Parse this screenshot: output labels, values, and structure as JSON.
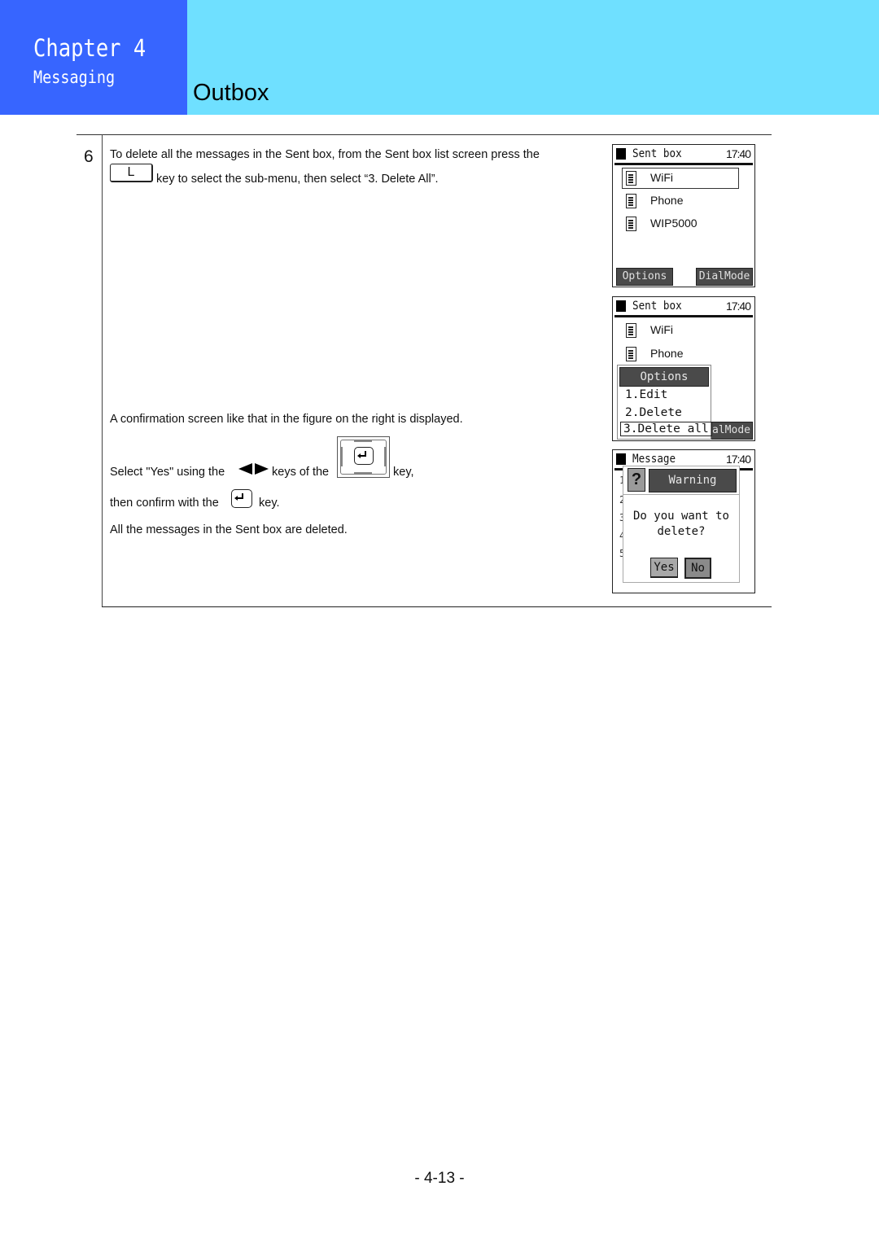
{
  "header": {
    "chapter": "Chapter 4",
    "chapter_subtitle": "Messaging",
    "section_title": "Outbox",
    "colors": {
      "chapter_bg": "#3765ff",
      "section_bg": "#6fe0ff"
    }
  },
  "step": {
    "number": "6",
    "intro_line1": "To delete all the messages in the Sent box, from the Sent box list screen press the",
    "l_key_label": "L",
    "intro_line2": "key to select the sub-menu, then select “3. Delete All”.",
    "confirm_text": "A confirmation screen like that in the figure on the right is displayed.",
    "select_prefix": "Select \"Yes\" using the",
    "select_middle": "keys of the",
    "select_suffix": "key,",
    "confirm_prefix": "then confirm with the",
    "confirm_suffix": "key.",
    "result_text": "All the messages in the Sent box are deleted."
  },
  "screens": {
    "sent_box": {
      "title": "Sent box",
      "time": "17:40",
      "items": [
        {
          "label": "WiFi",
          "selected": true
        },
        {
          "label": "Phone",
          "selected": false
        },
        {
          "label": "WIP5000",
          "selected": false
        }
      ],
      "softkey_left": "Options",
      "softkey_right": "DialMode"
    },
    "options_screen": {
      "title": "Sent box",
      "time": "17:40",
      "items": [
        {
          "label": "WiFi"
        },
        {
          "label": "Phone"
        }
      ],
      "menu_title": "Options",
      "menu_items": [
        "1.Edit",
        "2.Delete",
        "3.Delete all"
      ],
      "selected_menu_item": "3.Delete all",
      "softkey_right_partial": "alMode"
    },
    "warning_screen": {
      "title": "Message",
      "time": "17:40",
      "dialog_icon": "question-icon",
      "dialog_title": "Warning",
      "dialog_line1": "Do you want to",
      "dialog_line2": "delete?",
      "yes_label": "Yes",
      "no_label": "No",
      "background_numbers": [
        "1",
        "2",
        "3",
        "4",
        "5"
      ]
    }
  },
  "footer": {
    "page_number": "- 4-13 -"
  }
}
